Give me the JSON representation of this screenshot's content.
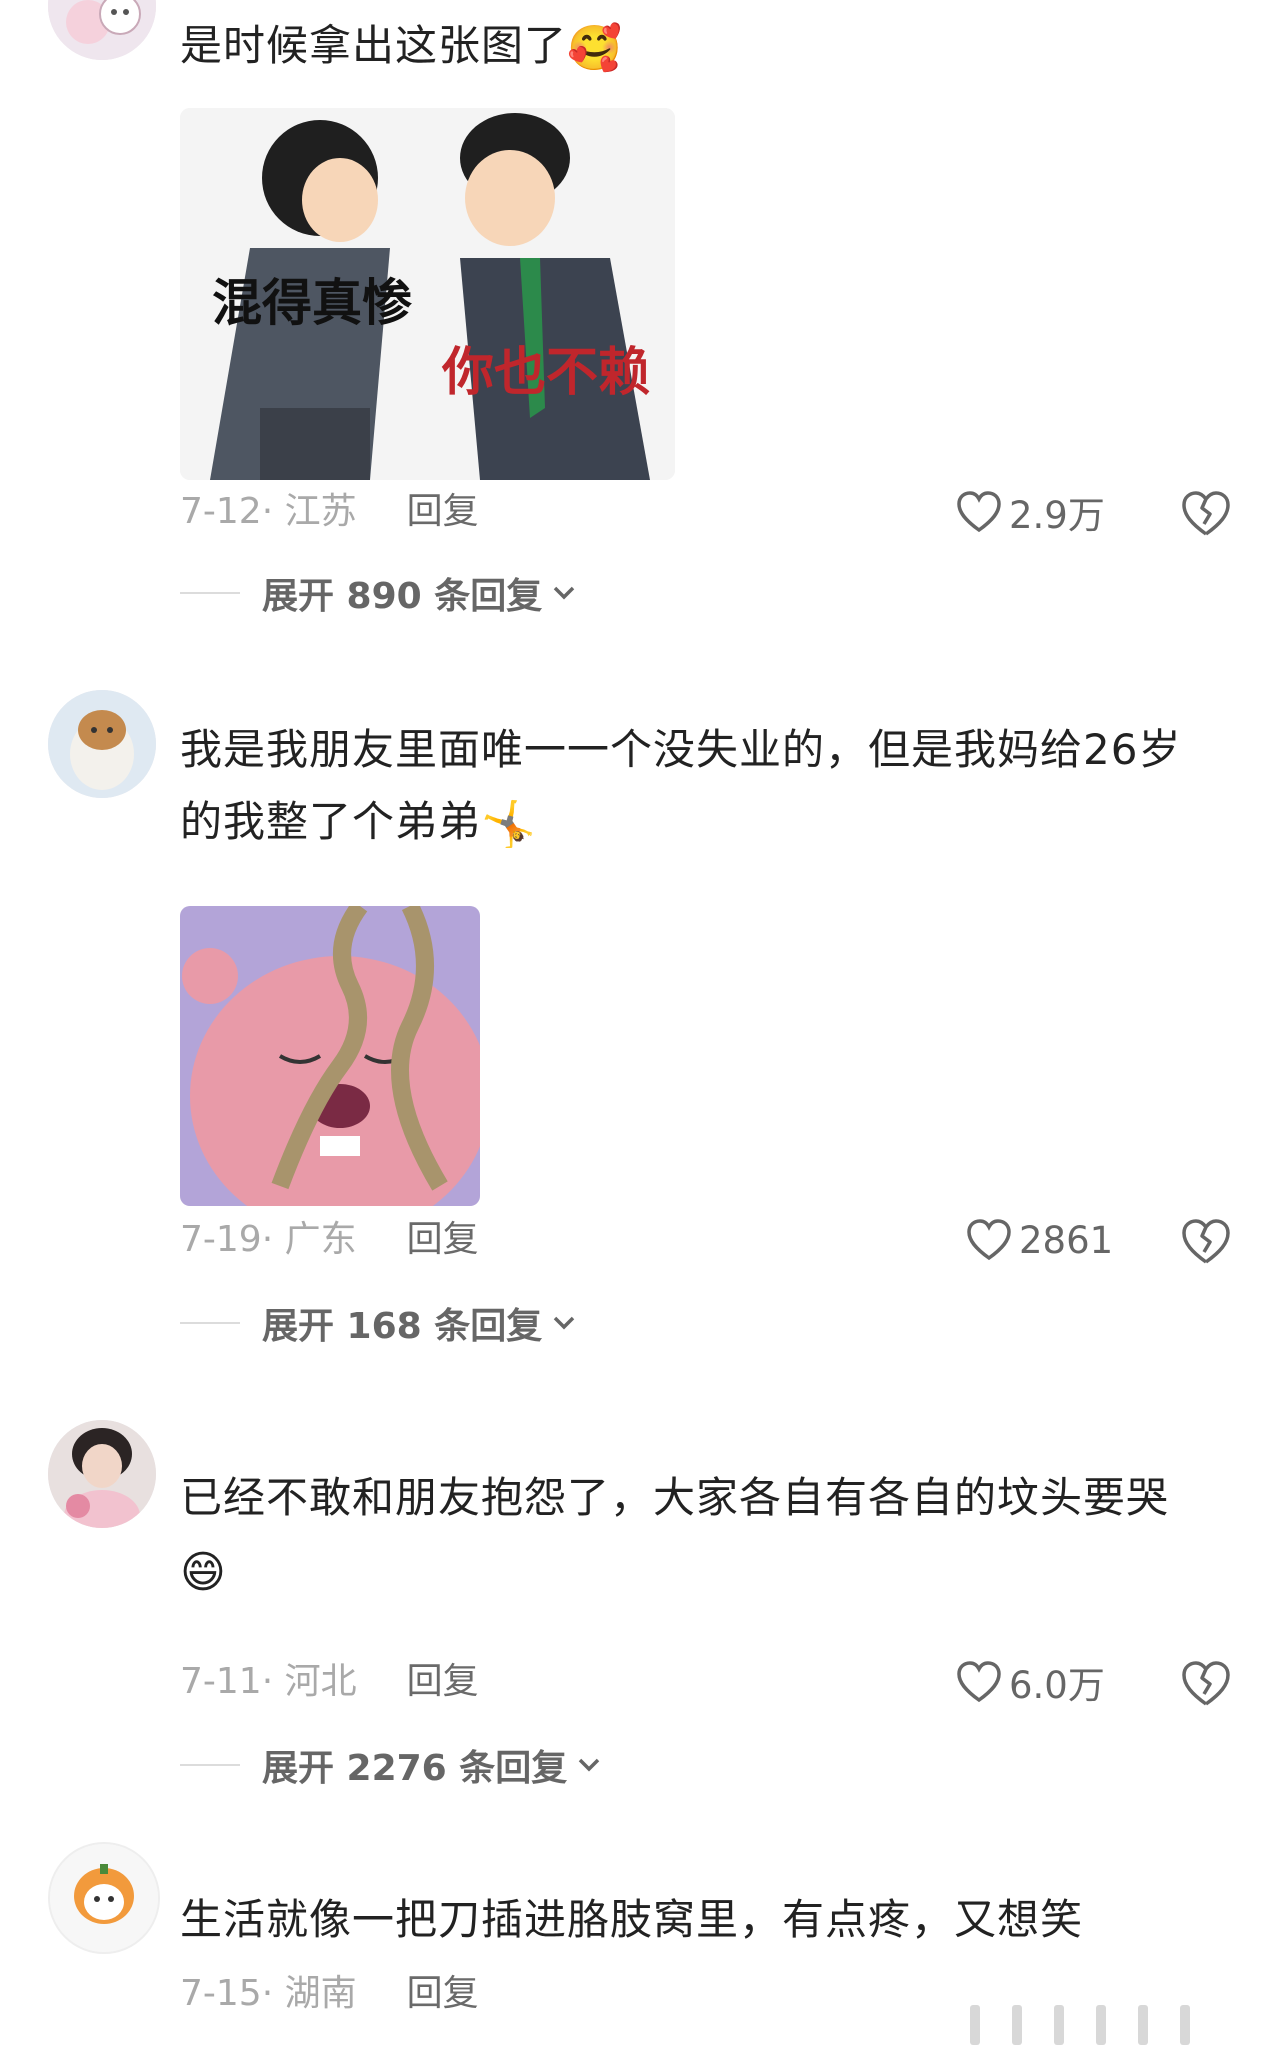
{
  "comments": [
    {
      "username": "",
      "text": "是时候拿出这张图了",
      "emoji": "🥰",
      "sticker": {
        "left_caption": "混得真惨",
        "right_caption": "你也不赖"
      },
      "date_location": "7-12· 江苏",
      "reply_label": "回复",
      "likes": "2.9万",
      "expand_label": "展开 890 条回复"
    },
    {
      "username": "",
      "text_line1": "我是我朋友里面唯一一个没失业的，但是我妈给26岁",
      "text_line2": "的我整了个弟弟",
      "emoji": "🤸",
      "date_location": "7-19· 广东",
      "reply_label": "回复",
      "likes": "2861",
      "expand_label": "展开 168 条回复"
    },
    {
      "username": "",
      "text": "已经不敢和朋友抱怨了，大家各自有各自的坟头要哭",
      "emoji": "😄",
      "date_location": "7-11· 河北",
      "reply_label": "回复",
      "likes": "6.0万",
      "expand_label": "展开 2276 条回复"
    },
    {
      "username": "",
      "text": "生活就像一把刀插进胳肢窝里，有点疼，又想笑",
      "date_location": "7-15· 湖南",
      "reply_label": "回复"
    }
  ],
  "colors": {
    "text": "#222222",
    "meta": "#a9a9a9",
    "icon": "#666666"
  },
  "icons": {
    "like": "heart-outline-icon",
    "dislike": "broken-heart-icon",
    "expand": "chevron-down-icon"
  }
}
